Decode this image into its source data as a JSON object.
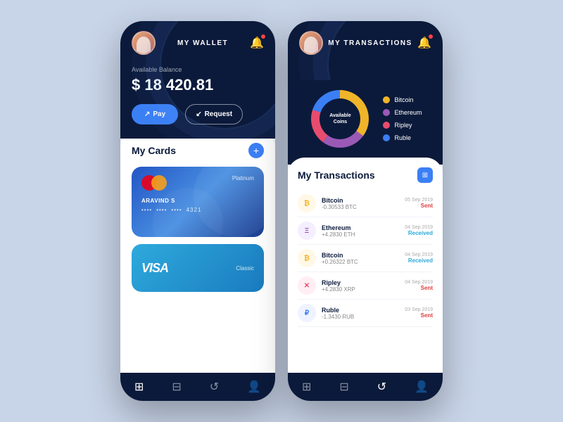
{
  "wallet": {
    "title": "MY WALLET",
    "balance_label": "Available Balance",
    "balance": "$ 18 420.81",
    "pay_label": "Pay",
    "request_label": "Request",
    "my_cards_label": "My Cards",
    "cards": [
      {
        "type": "Platinum",
        "holder": "ARAVIND S",
        "number_dots": "••••  ••••  ••••",
        "last4": "4321",
        "brand": "mastercard"
      },
      {
        "type": "Classic",
        "brand": "visa"
      }
    ]
  },
  "transactions": {
    "title": "MY TRANSACTIONS",
    "section_label": "My Transactions",
    "donut_label": "Available\nCoins",
    "legend": [
      {
        "name": "Bitcoin",
        "color": "#f0b429"
      },
      {
        "name": "Ethereum",
        "color": "#9b59b6"
      },
      {
        "name": "Ripley",
        "color": "#e74c6e"
      },
      {
        "name": "Ruble",
        "color": "#3b7ff5"
      }
    ],
    "items": [
      {
        "coin": "Bitcoin",
        "amount": "-0.30533 BTC",
        "date": "05 Sep 2019",
        "status": "Sent",
        "color": "#f0b429",
        "symbol": "₿"
      },
      {
        "coin": "Ethereum",
        "amount": "+4.2830 ETH",
        "date": "04 Sep 2019",
        "status": "Received",
        "color": "#9b59b6",
        "symbol": "Ξ"
      },
      {
        "coin": "Bitcoin",
        "amount": "+0.26322 BTC",
        "date": "04 Sep 2019",
        "status": "Received",
        "color": "#f0b429",
        "symbol": "₿"
      },
      {
        "coin": "Ripley",
        "amount": "+4.2830 XRP",
        "date": "04 Sep 2019",
        "status": "Sent",
        "color": "#e74c6e",
        "symbol": "✕"
      },
      {
        "coin": "Ruble",
        "amount": "-1.3430 RUB",
        "date": "03 Sep 2019",
        "status": "Sent",
        "color": "#3b7ff5",
        "symbol": "₽"
      }
    ]
  },
  "nav": {
    "items": [
      "⊞",
      "⊟",
      "↺",
      "👤"
    ]
  }
}
